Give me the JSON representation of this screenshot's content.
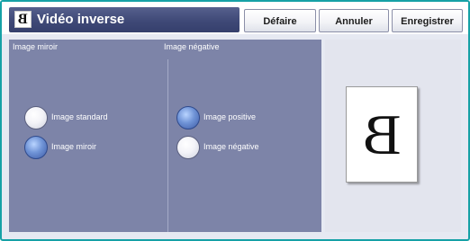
{
  "header": {
    "title": "Vidéo inverse",
    "icon_letter": "B",
    "buttons": {
      "undo": "Défaire",
      "cancel": "Annuler",
      "save": "Enregistrer"
    }
  },
  "mirror_group": {
    "label": "Image miroir",
    "options": [
      {
        "label": "Image standard",
        "selected": false
      },
      {
        "label": "Image miroir",
        "selected": true
      }
    ]
  },
  "negative_group": {
    "label": "Image négative",
    "options": [
      {
        "label": "Image positive",
        "selected": true
      },
      {
        "label": "Image négative",
        "selected": false
      }
    ]
  },
  "preview": {
    "letter": "B"
  },
  "colors": {
    "frame_border": "#16a1a6",
    "title_bar": "#3f4977",
    "panel": "#7d84a8",
    "radio_selected": "#6f93d6"
  }
}
